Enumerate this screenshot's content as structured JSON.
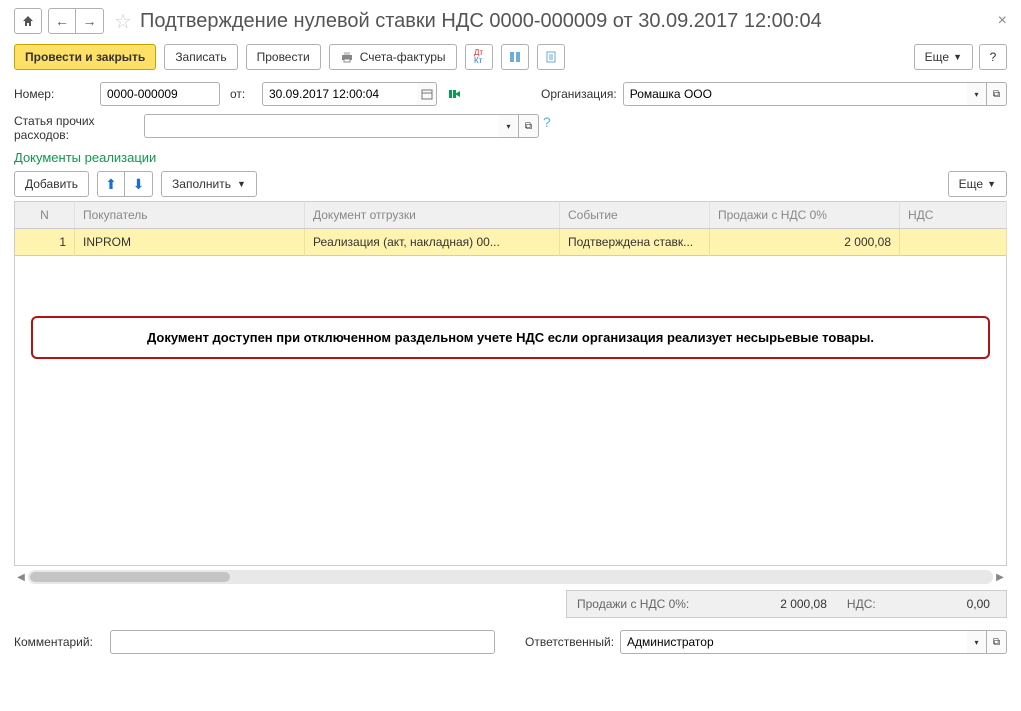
{
  "title": "Подтверждение нулевой ставки НДС 0000-000009 от 30.09.2017 12:00:04",
  "toolbar": {
    "post_close": "Провести и закрыть",
    "save": "Записать",
    "post": "Провести",
    "invoice": "Счета-фактуры",
    "more": "Еще",
    "help": "?"
  },
  "fields": {
    "number_label": "Номер:",
    "number_value": "0000-000009",
    "from_label": "от:",
    "date_value": "30.09.2017 12:00:04",
    "org_label": "Организация:",
    "org_value": "Ромашка ООО",
    "expense_label_line1": "Статья прочих",
    "expense_label_line2": "расходов:",
    "expense_value": ""
  },
  "section_title": "Документы реализации",
  "grid_toolbar": {
    "add": "Добавить",
    "fill": "Заполнить",
    "more": "Еще"
  },
  "columns": {
    "n": "N",
    "buyer": "Покупатель",
    "doc": "Документ отгрузки",
    "event": "Событие",
    "sales": "Продажи с НДС 0%",
    "vat": "НДС"
  },
  "rows": [
    {
      "n": "1",
      "buyer": "INPROM",
      "doc": "Реализация (акт, накладная) 00...",
      "event": "Подтверждена ставк...",
      "sales": "2 000,08",
      "vat": ""
    }
  ],
  "callout": "Документ доступен при отключенном раздельном учете НДС если организация реализует несырьевые товары.",
  "totals": {
    "sales_label": "Продажи с НДС 0%:",
    "sales_value": "2 000,08",
    "vat_label": "НДС:",
    "vat_value": "0,00"
  },
  "footer": {
    "comment_label": "Комментарий:",
    "comment_value": "",
    "resp_label": "Ответственный:",
    "resp_value": "Администратор"
  }
}
